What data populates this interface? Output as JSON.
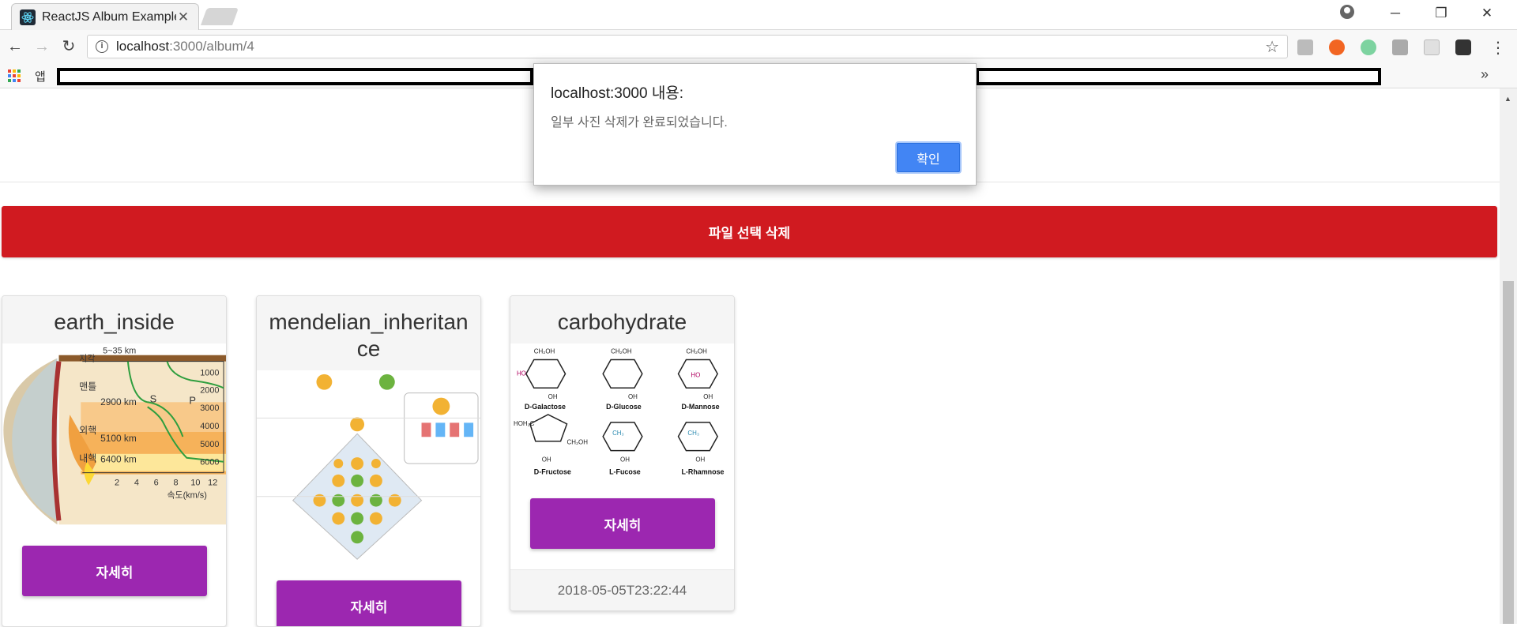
{
  "browser": {
    "tab_title": "ReactJS Album Example",
    "tab_close": "✕",
    "url_host": "localhost",
    "url_path": ":3000/album/4",
    "bookmarks_apps_label": "앱",
    "bookmarks_more": "»",
    "window_controls": {
      "minimize": "─",
      "restore": "❐",
      "close": "✕"
    },
    "menu": "⋮"
  },
  "page": {
    "delete_button": "파일 선택 삭제",
    "cards": [
      {
        "title": "earth_inside",
        "button": "자세히",
        "image": "earth-cross-section-diagram"
      },
      {
        "title": "mendelian_inheritance",
        "button": "자세히",
        "image": "mendelian-inheritance-diagram"
      },
      {
        "title": "carbohydrate",
        "button": "자세히",
        "image": "carbohydrate-structures-diagram",
        "date": "2018-05-05T23:22:44"
      }
    ]
  },
  "earth_diagram": {
    "top_label": "5~35 km",
    "crust": "지각",
    "mantle": "맨틀",
    "outer_core": "외핵",
    "inner_core": "내핵",
    "depth_2900": "2900 km",
    "depth_5100": "5100 km",
    "depth_6400": "6400 km",
    "s_wave": "S",
    "p_wave": "P",
    "right_ticks": [
      "1000",
      "2000",
      "3000",
      "4000",
      "5000",
      "6000"
    ],
    "x_ticks": [
      "2",
      "4",
      "6",
      "8",
      "10",
      "12"
    ],
    "x_label": "속도(km/s)"
  },
  "carbo_diagram": {
    "labels": [
      "D-Galactose",
      "D-Glucose",
      "D-Mannose",
      "D-Fructose",
      "L-Fucose",
      "L-Rhamnose"
    ]
  },
  "dialog": {
    "title": "localhost:3000 내용:",
    "message": "일부 사진 삭제가 완료되었습니다.",
    "ok": "확인"
  },
  "colors": {
    "delete_bar": "#d01a20",
    "detail_button": "#9c27b0",
    "dialog_ok": "#4285f4"
  }
}
